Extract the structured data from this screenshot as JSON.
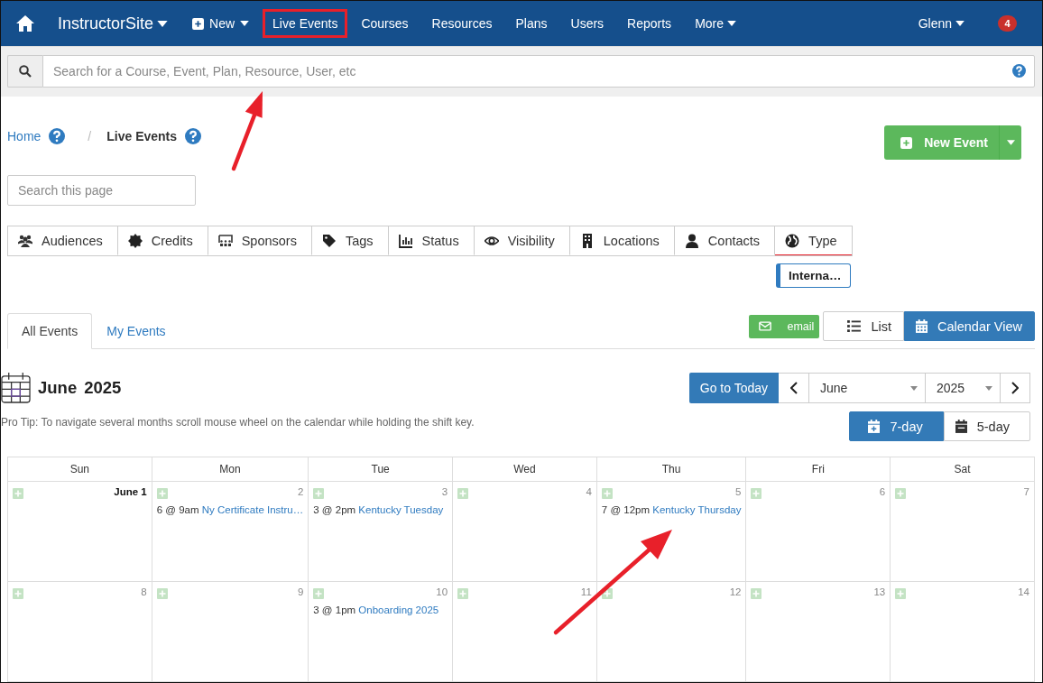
{
  "nav": {
    "brand": "InstructorSite",
    "new_label": "New",
    "items": [
      {
        "label": "Live Events",
        "highlighted": true,
        "dropdown": false
      },
      {
        "label": "Courses",
        "highlighted": false,
        "dropdown": false
      },
      {
        "label": "Resources",
        "highlighted": false,
        "dropdown": false
      },
      {
        "label": "Plans",
        "highlighted": false,
        "dropdown": false
      },
      {
        "label": "Users",
        "highlighted": false,
        "dropdown": false
      },
      {
        "label": "Reports",
        "highlighted": false,
        "dropdown": false
      },
      {
        "label": "More",
        "highlighted": false,
        "dropdown": true
      }
    ],
    "user": "Glenn",
    "badge": "4"
  },
  "global_search": {
    "placeholder": "Search for a Course, Event, Plan, Resource, User, etc"
  },
  "breadcrumb": [
    {
      "label": "Home",
      "current": false
    },
    {
      "label": "Live Events",
      "current": true
    }
  ],
  "breadcrumb_separator": "/",
  "new_event_button": "New Event",
  "page_search": {
    "placeholder": "Search this page"
  },
  "filter_tabs": [
    {
      "label": "Audiences",
      "active": false
    },
    {
      "label": "Credits",
      "active": false
    },
    {
      "label": "Sponsors",
      "active": false
    },
    {
      "label": "Tags",
      "active": false
    },
    {
      "label": "Status",
      "active": false
    },
    {
      "label": "Visibility",
      "active": false
    },
    {
      "label": "Locations",
      "active": false
    },
    {
      "label": "Contacts",
      "active": false
    },
    {
      "label": "Type",
      "active": true
    }
  ],
  "filter_chip": "Interna…",
  "tabs": [
    {
      "label": "All Events",
      "selected": true
    },
    {
      "label": "My Events",
      "selected": false
    }
  ],
  "email_button": "email",
  "views": [
    {
      "label": "List",
      "selected": false
    },
    {
      "label": "Calendar View",
      "selected": true
    }
  ],
  "calendar": {
    "month": "June",
    "year": "2025",
    "go_to_today": "Go to Today",
    "month_select": "June",
    "year_select": "2025",
    "pro_tip": "Pro Tip: To navigate several months scroll mouse wheel on the calendar while holding the shift key.",
    "ranges": [
      {
        "label": "7-day",
        "selected": true
      },
      {
        "label": "5-day",
        "selected": false
      }
    ],
    "weekdays": [
      "Sun",
      "Mon",
      "Tue",
      "Wed",
      "Thu",
      "Fri",
      "Sat"
    ],
    "weeks": [
      [
        {
          "day": "June 1",
          "emphasized": true
        },
        {
          "day": "2",
          "emphasized": false,
          "events": [
            {
              "when": "6 @ 9am",
              "title": "Ny Certificate Instru…"
            }
          ]
        },
        {
          "day": "3",
          "emphasized": false,
          "events": [
            {
              "when": "3 @ 2pm",
              "title": "Kentucky Tuesday"
            }
          ]
        },
        {
          "day": "4",
          "emphasized": false
        },
        {
          "day": "5",
          "emphasized": false,
          "events": [
            {
              "when": "7 @ 12pm",
              "title": "Kentucky Thursday"
            }
          ]
        },
        {
          "day": "6",
          "emphasized": false
        },
        {
          "day": "7",
          "emphasized": false
        }
      ],
      [
        {
          "day": "8",
          "emphasized": false
        },
        {
          "day": "9",
          "emphasized": false
        },
        {
          "day": "10",
          "emphasized": false,
          "events": [
            {
              "when": "3 @ 1pm",
              "title": "Onboarding 2025"
            }
          ]
        },
        {
          "day": "11",
          "emphasized": false
        },
        {
          "day": "12",
          "emphasized": false
        },
        {
          "day": "13",
          "emphasized": false
        },
        {
          "day": "14",
          "emphasized": false
        }
      ]
    ]
  }
}
